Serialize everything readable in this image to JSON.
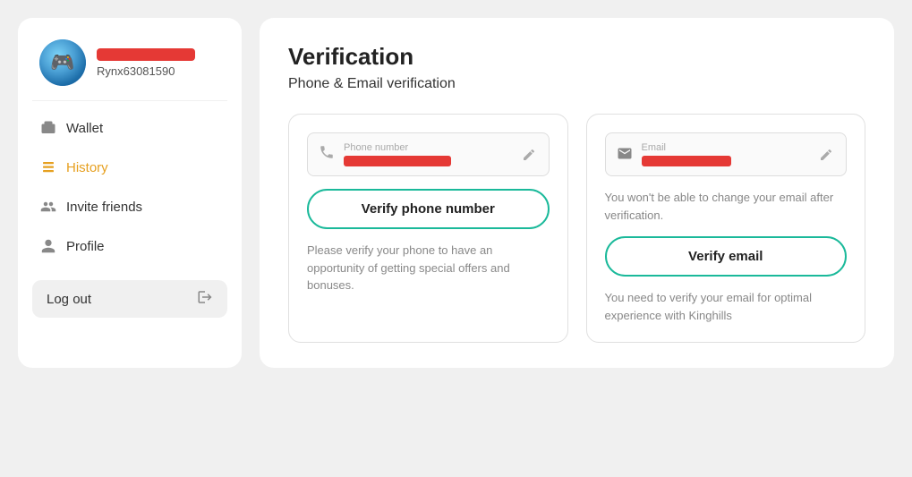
{
  "sidebar": {
    "username": "Rynx63081590",
    "nav_items": [
      {
        "id": "wallet",
        "label": "Wallet",
        "active": false
      },
      {
        "id": "history",
        "label": "History",
        "active": true
      },
      {
        "id": "invite",
        "label": "Invite friends",
        "active": false
      },
      {
        "id": "profile",
        "label": "Profile",
        "active": false
      }
    ],
    "logout_label": "Log out"
  },
  "main": {
    "page_title": "Verification",
    "page_subtitle": "Phone & Email verification",
    "phone_card": {
      "field_label": "Phone number",
      "verify_btn_label": "Verify phone number",
      "note": "Please verify your phone to have an opportunity of getting special offers and bonuses."
    },
    "email_card": {
      "field_label": "Email",
      "verify_btn_label": "Verify email",
      "warning": "You won't be able to change your email after verification.",
      "note": "You need to verify your email for optimal experience with Kinghills"
    }
  },
  "colors": {
    "accent_green": "#1ab99a",
    "accent_red": "#e53935",
    "accent_orange": "#e6a020"
  }
}
